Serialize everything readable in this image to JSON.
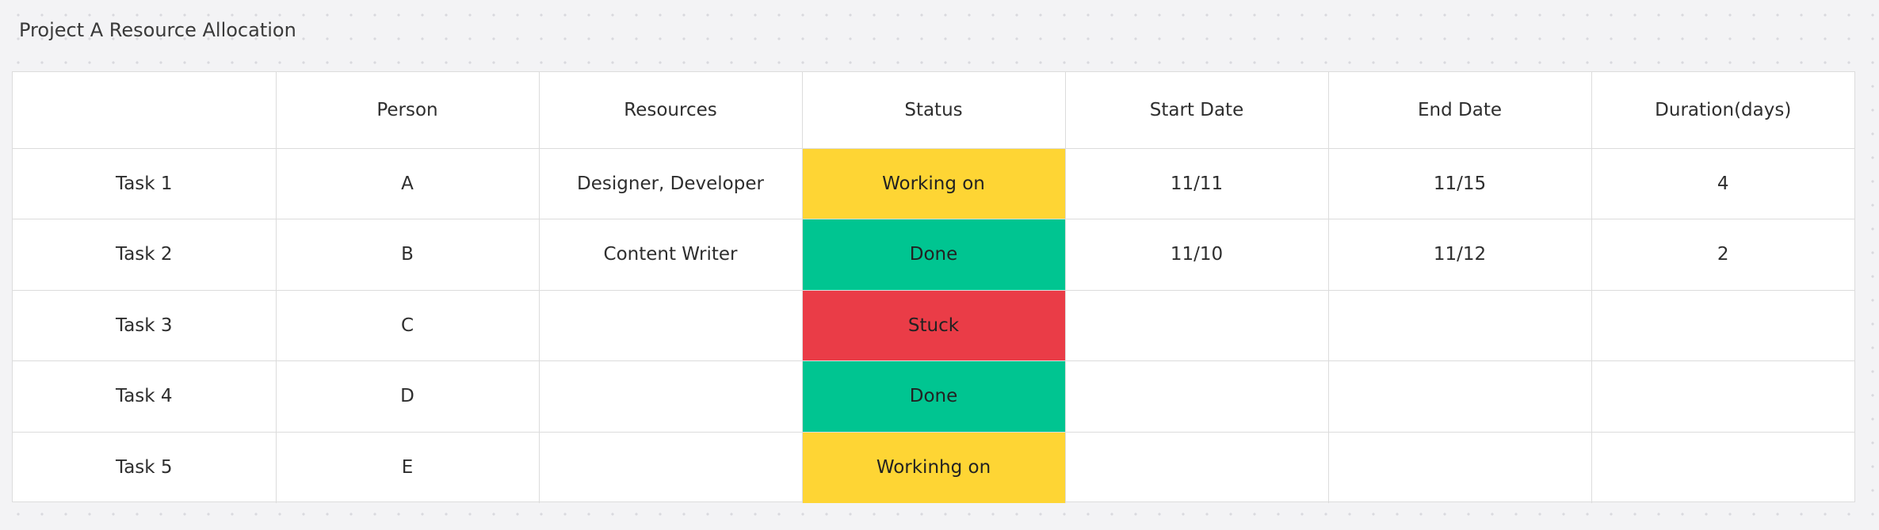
{
  "board": {
    "title": "Project A Resource Allocation"
  },
  "table": {
    "headers": [
      "",
      "Person",
      "Resources",
      "Status",
      "Start Date",
      "End Date",
      "Duration(days)"
    ],
    "rows": [
      {
        "task": "Task 1",
        "person": "A",
        "resources": "Designer, Developer",
        "status": "Working on",
        "status_color": "#fed534",
        "start": "11/11",
        "end": "11/15",
        "duration": "4"
      },
      {
        "task": "Task 2",
        "person": "B",
        "resources": "Content Writer",
        "status": "Done",
        "status_color": "#00c591",
        "start": "11/10",
        "end": "11/12",
        "duration": "2"
      },
      {
        "task": "Task 3",
        "person": "C",
        "resources": "",
        "status": "Stuck",
        "status_color": "#ea3c47",
        "start": "",
        "end": "",
        "duration": ""
      },
      {
        "task": "Task 4",
        "person": "D",
        "resources": "",
        "status": "Done",
        "status_color": "#00c591",
        "start": "",
        "end": "",
        "duration": ""
      },
      {
        "task": "Task 5",
        "person": "E",
        "resources": "",
        "status": "Workinhg on",
        "status_color": "#fed534",
        "start": "",
        "end": "",
        "duration": ""
      }
    ]
  },
  "colors": {
    "background": "#f3f3f5",
    "grid_line": "#dcdcdc",
    "status_working": "#fed534",
    "status_done": "#00c591",
    "status_stuck": "#ea3c47"
  }
}
